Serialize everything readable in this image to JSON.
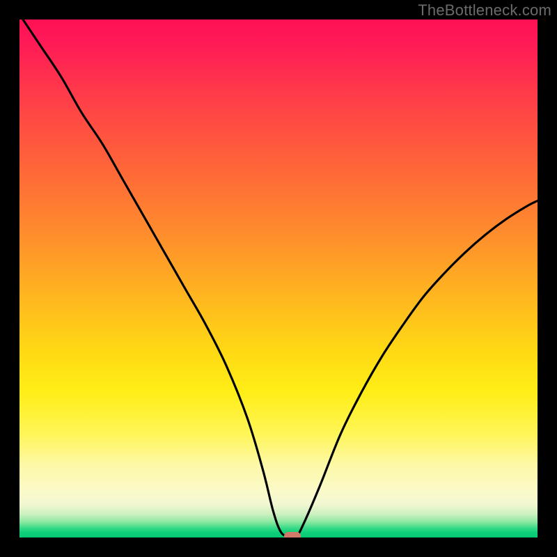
{
  "watermark": "TheBottleneck.com",
  "colors": {
    "background": "#000000",
    "curve_stroke": "#000000",
    "marker": "#d17a6a"
  },
  "chart_data": {
    "type": "line",
    "title": "",
    "xlabel": "",
    "ylabel": "",
    "xlim": [
      0,
      100
    ],
    "ylim": [
      0,
      100
    ],
    "grid": false,
    "legend": false,
    "series": [
      {
        "name": "bottleneck-curve",
        "x": [
          0,
          4,
          8,
          12,
          16,
          20,
          24,
          28,
          32,
          36,
          40,
          44,
          47,
          49,
          50.5,
          52,
          53.5,
          55,
          58,
          62,
          66,
          70,
          74,
          78,
          82,
          86,
          90,
          94,
          98,
          100
        ],
        "y": [
          101,
          95,
          89,
          82,
          76,
          69,
          62,
          55,
          48,
          41,
          33,
          23,
          13,
          5,
          1,
          0.3,
          0.3,
          3,
          10,
          20,
          28,
          35,
          41,
          46.5,
          51,
          55,
          58.5,
          61.5,
          64,
          65
        ]
      }
    ],
    "annotations": [
      {
        "name": "optimal-point-marker",
        "x": 52.7,
        "y": 0.3
      }
    ]
  }
}
